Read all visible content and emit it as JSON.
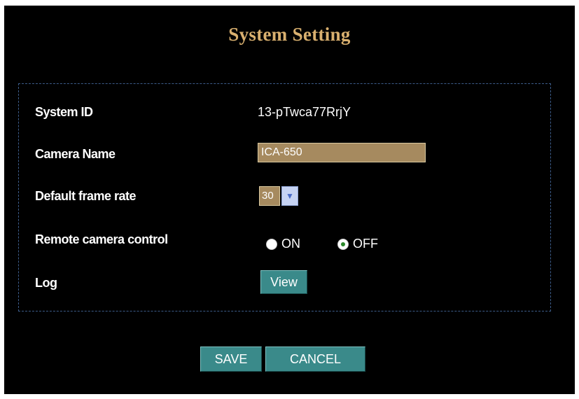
{
  "page": {
    "title": "System Setting"
  },
  "settings": {
    "system_id": {
      "label": "System ID",
      "value": "13-pTwca77RrjY"
    },
    "camera_name": {
      "label": "Camera Name",
      "value": "ICA-650"
    },
    "frame_rate": {
      "label": "Default frame rate",
      "value": "30"
    },
    "remote_control": {
      "label": "Remote camera control",
      "on_label": "ON",
      "off_label": "OFF",
      "selected": "OFF"
    },
    "log": {
      "label": "Log",
      "view_label": "View"
    }
  },
  "actions": {
    "save_label": "SAVE",
    "cancel_label": "CANCEL"
  }
}
